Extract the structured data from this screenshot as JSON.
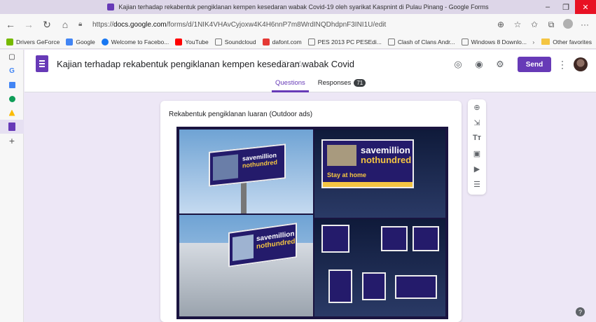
{
  "window": {
    "title": "Kajian terhadap rekabentuk pengiklanan kempen kesedaran wabak Covid-19 oleh syarikat Kaspnint di Pulau Pinang - Google Forms"
  },
  "browser": {
    "url_prefix": "https://",
    "url_host": "docs.google.com",
    "url_path": "/forms/d/1NIK4VHAvCyjoxw4K4H6nnP7m8WrdINQDhdpnF3INI1U/edit"
  },
  "bookmarks": [
    {
      "label": "Drivers GeForce",
      "color": "#76b900"
    },
    {
      "label": "Google",
      "color": "#4285f4"
    },
    {
      "label": "Welcome to Facebo...",
      "color": "#1877f2"
    },
    {
      "label": "YouTube",
      "color": "#ff0000"
    },
    {
      "label": "Soundcloud",
      "color": "#9e9e9e"
    },
    {
      "label": "dafont.com",
      "color": "#e53935"
    },
    {
      "label": "PES 2013 PC PESEdi...",
      "color": "#9e9e9e"
    },
    {
      "label": "Clash of Clans Andr...",
      "color": "#9e9e9e"
    },
    {
      "label": "Windows 8 Downlo...",
      "color": "#9e9e9e"
    }
  ],
  "other_favorites": "Other favorites",
  "form": {
    "title": "Kajian terhadap rekabentuk pengiklanan kempen kesedaran wabak Covid",
    "send_label": "Send",
    "tabs": {
      "questions": "Questions",
      "responses": "Responses",
      "responses_count": "71"
    }
  },
  "card": {
    "question_title": "Rekabentuk pengiklanan luaran (Outdoor ads)"
  },
  "ad": {
    "line1": "savemillion",
    "line2": "nothundred",
    "stay": "Stay at home"
  },
  "colors": {
    "accent": "#673ab7",
    "brand_navy": "#241b6b"
  }
}
